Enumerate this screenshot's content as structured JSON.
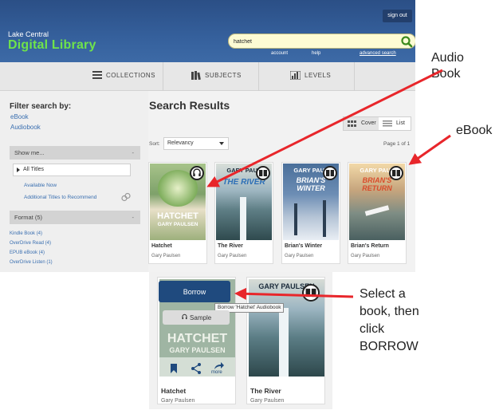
{
  "header": {
    "sign_out": "sign out",
    "library_small": "Lake Central",
    "library_big": "Digital Library",
    "search_value": "hatchet",
    "links": [
      "account",
      "help",
      "advanced search"
    ]
  },
  "nav": {
    "collections": "COLLECTIONS",
    "subjects": "SUBJECTS",
    "levels": "LEVELS"
  },
  "filters": {
    "title": "Filter search by:",
    "ebook": "eBook",
    "audiobook": "Audiobook",
    "show_me": "Show me...",
    "show_me_dash": "-",
    "all_titles": "All Titles",
    "available_now": "Available Now",
    "additional": "Additional Titles to Recommend",
    "format": "Format (5)",
    "format_dash": "-",
    "formats": [
      "Kindle Book (4)",
      "OverDrive Read (4)",
      "EPUB eBook (4)",
      "OverDrive Listen (1)"
    ]
  },
  "results": {
    "title": "Search Results",
    "cover_label": "Cover",
    "list_label": "List",
    "sort_label": "Sort:",
    "sort_value": "Relevancy",
    "page_label": "Page 1 of 1"
  },
  "books": [
    {
      "title": "Hatchet",
      "author": "Gary Paulsen",
      "cover_top": "HATCHET",
      "cover_bottom": "GARY PAULSEN",
      "format": "audiobook"
    },
    {
      "title": "The River",
      "author": "Gary Paulsen",
      "cover_top": "GARY PAUL",
      "cover_bottom": "THE RIVER",
      "format": "ebook"
    },
    {
      "title": "Brian's Winter",
      "author": "Gary Paulsen",
      "cover_top": "GARY PAUL",
      "cover_bottom": "BRIAN'S WINTER",
      "format": "ebook"
    },
    {
      "title": "Brian's Return",
      "author": "Gary Paulsen",
      "cover_top": "GARY PAUL",
      "cover_bottom": "BRIAN'S RETURN",
      "format": "ebook"
    }
  ],
  "detail": {
    "borrow": "Borrow",
    "tooltip": "Borrow 'Hatchet' Audiobook",
    "sample": "Sample",
    "more": "more",
    "card1_title": "Hatchet",
    "card1_author": "Gary Paulsen",
    "card1_cover": "HATCHET",
    "card1_cover2": "GARY PAULSEN",
    "card2_title": "The River",
    "card2_author": "Gary Paulsen",
    "card2_cover": "GARY PAULSEN"
  },
  "annotations": {
    "audio_book": [
      "Audio",
      "Book"
    ],
    "ebook": "eBook",
    "select": [
      "Select a",
      "book, then",
      "click",
      "BORROW"
    ]
  }
}
